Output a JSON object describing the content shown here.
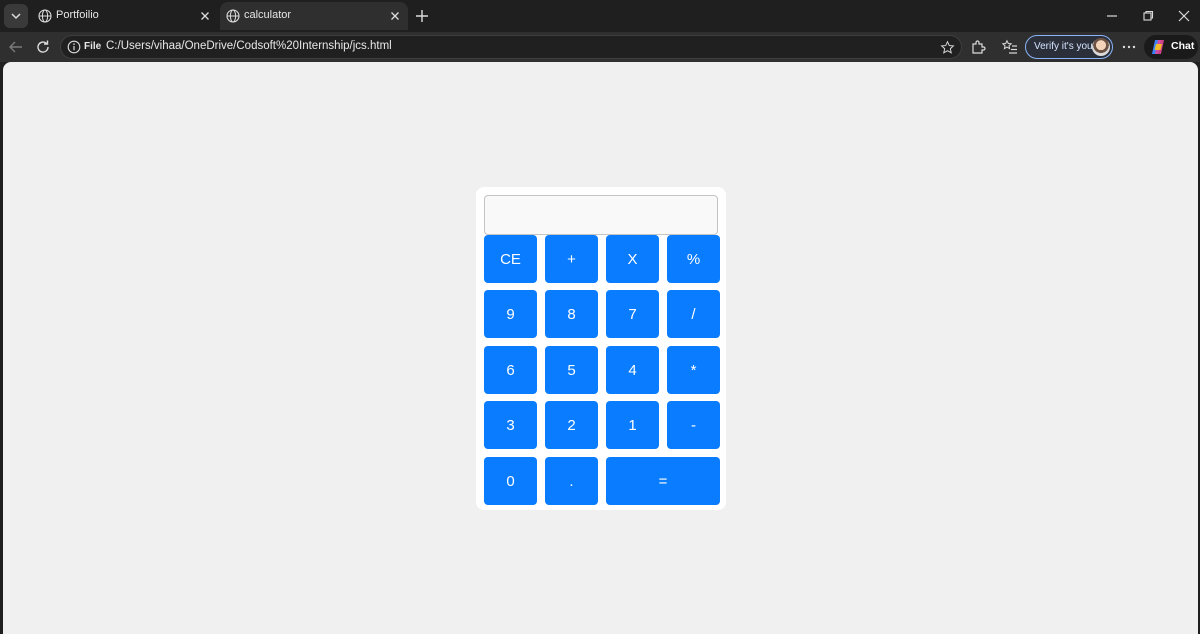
{
  "browser": {
    "tabs": [
      {
        "title": "Portfoilio",
        "active": false
      },
      {
        "title": "calculator",
        "active": true
      }
    ],
    "address": {
      "scheme_label": "File",
      "url": "C:/Users/vihaa/OneDrive/Codsoft%20Internship/jcs.html"
    },
    "verify_label": "Verify it's you",
    "chat_label": "Chat"
  },
  "calculator": {
    "display_value": "",
    "keys": {
      "clear": "CE",
      "plus": "+",
      "times": "X",
      "percent": "%",
      "nine": "9",
      "eight": "8",
      "seven": "7",
      "divide": "/",
      "six": "6",
      "five": "5",
      "four": "4",
      "multiply": "*",
      "three": "3",
      "two": "2",
      "one": "1",
      "minus": "-",
      "zero": "0",
      "decimal": ".",
      "equals": "="
    },
    "key_color": "#0a7cff",
    "background_color": "#f0f0f0"
  }
}
